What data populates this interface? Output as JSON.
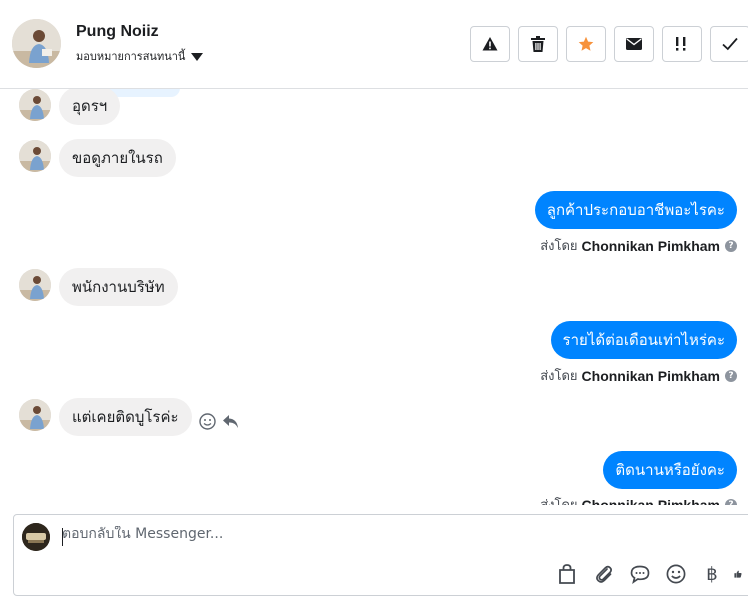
{
  "header": {
    "contact_name": "Pung Noiiz",
    "assign_label": "มอบหมายการสนทนานี้",
    "tools": [
      {
        "name": "warning",
        "icon": "warning-icon",
        "color": "#1c1e21"
      },
      {
        "name": "delete",
        "icon": "trash-icon",
        "color": "#1c1e21"
      },
      {
        "name": "star",
        "icon": "star-icon",
        "color": "#f7923b"
      },
      {
        "name": "mark-unread",
        "icon": "envelope-icon",
        "color": "#1c1e21"
      },
      {
        "name": "priority",
        "icon": "priority-icon",
        "color": "#1c1e21"
      },
      {
        "name": "done",
        "icon": "check-icon",
        "color": "#1c1e21"
      }
    ]
  },
  "messages": {
    "incoming": [
      {
        "text": "อุดรฯ"
      },
      {
        "text": "ขอดูภายในรถ"
      },
      {
        "text": "พนักงานบริษัท"
      },
      {
        "text": "แต่เคยติดบูโรค่ะ"
      }
    ],
    "outgoing": [
      {
        "text": "ลูกค้าประกอบอาชีพอะไรคะ",
        "sent_by_label": "ส่งโดย",
        "sender": "Chonnikan Pimkham"
      },
      {
        "text": "รายได้ต่อเดือนเท่าไหร่คะ",
        "sent_by_label": "ส่งโดย",
        "sender": "Chonnikan Pimkham"
      },
      {
        "text": "ติดนานหรือยังคะ",
        "sent_by_label": "ส่งโดย",
        "sender": "Chonnikan Pimkham"
      }
    ],
    "info_glyph": "?"
  },
  "composer": {
    "placeholder": "ตอบกลับใน Messenger...",
    "value": "",
    "tools": [
      "bag-icon",
      "paperclip-icon",
      "speech-bubble-icon",
      "emoji-icon",
      "baht-icon",
      "like-icon"
    ],
    "baht_glyph": "฿"
  },
  "colors": {
    "accent": "#0084ff",
    "bubble_incoming": "#f1f0f0",
    "star": "#f7923b",
    "border": "#ccd0d5"
  }
}
